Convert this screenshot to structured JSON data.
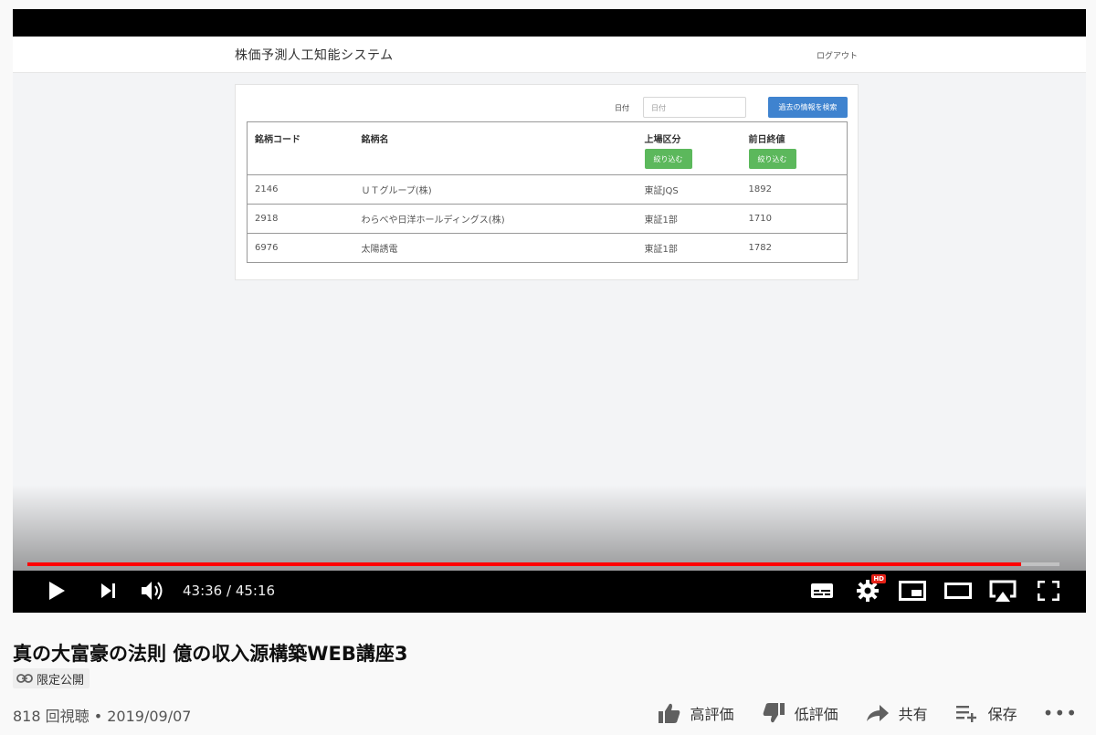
{
  "app": {
    "brand": "株価予測人工知能システム",
    "logout": "ログアウト",
    "date_label": "日付",
    "date_placeholder": "日付",
    "search_button": "過去の情報を検索",
    "columns": [
      "銘柄コード",
      "銘柄名",
      "上場区分",
      "前日終値"
    ],
    "filter_button": "絞り込む",
    "rows": [
      {
        "code": "2146",
        "name": "ＵＴグループ(株)",
        "market": "東証JQS",
        "close": "1892"
      },
      {
        "code": "2918",
        "name": "わらべや日洋ホールディングス(株)",
        "market": "東証1部",
        "close": "1710"
      },
      {
        "code": "6976",
        "name": "太陽誘電",
        "market": "東証1部",
        "close": "1782"
      }
    ]
  },
  "player": {
    "time": "43:36 / 45:16",
    "progress": 0.963,
    "hd_badge": "HD",
    "accent_color": "#ff0000"
  },
  "video": {
    "title": "真の大富豪の法則 億の収入源構築WEB講座3",
    "visibility": "限定公開",
    "meta": "818 回視聴 • 2019/09/07",
    "actions": {
      "like": "高評価",
      "dislike": "低評価",
      "share": "共有",
      "save": "保存",
      "more": "•••"
    }
  }
}
